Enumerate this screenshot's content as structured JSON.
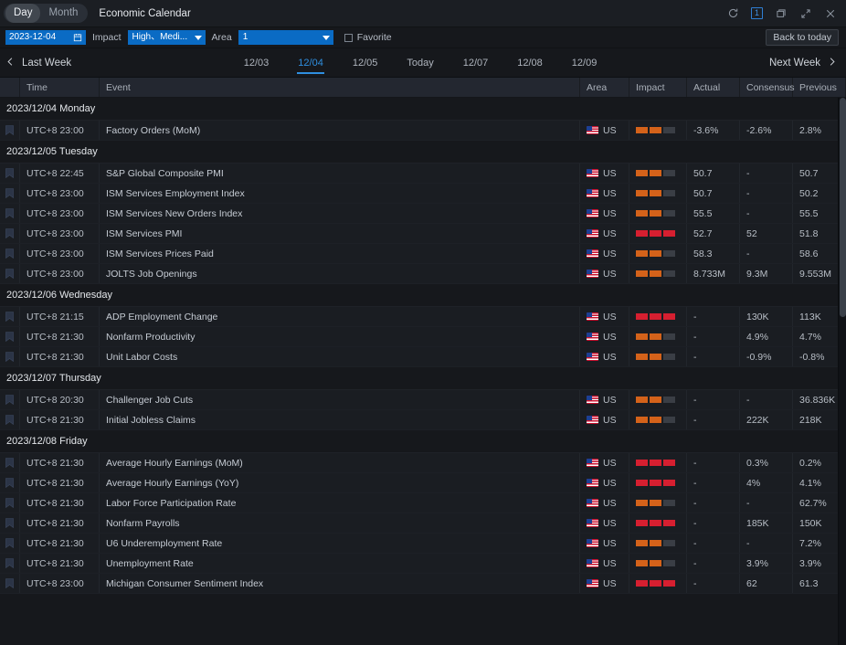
{
  "titlebar": {
    "view_tabs": [
      {
        "label": "Day",
        "active": true
      },
      {
        "label": "Month",
        "active": false
      }
    ],
    "app_title": "Economic Calendar",
    "icons": [
      "refresh-icon",
      "badge-one",
      "restore-window-icon",
      "expand-icon",
      "close-icon"
    ],
    "badge_text": "1"
  },
  "filterbar": {
    "date_value": "2023-12-04",
    "impact_label": "Impact",
    "impact_value": "High、Medi...",
    "area_label": "Area",
    "area_value": "1",
    "favorite_label": "Favorite",
    "back_to_today": "Back to today"
  },
  "weeknav": {
    "prev_label": "Last Week",
    "next_label": "Next Week",
    "days": [
      {
        "label": "12/03",
        "active": false
      },
      {
        "label": "12/04",
        "active": true
      },
      {
        "label": "12/05",
        "active": false
      },
      {
        "label": "Today",
        "active": false
      },
      {
        "label": "12/07",
        "active": false
      },
      {
        "label": "12/08",
        "active": false
      },
      {
        "label": "12/09",
        "active": false
      }
    ]
  },
  "table": {
    "columns": [
      "",
      "Time",
      "Event",
      "Area",
      "Impact",
      "Actual",
      "Consensus",
      "Previous"
    ],
    "groups": [
      {
        "label": "2023/12/04 Monday",
        "rows": [
          {
            "time": "UTC+8 23:00",
            "event": "Factory Orders (MoM)",
            "area": "US",
            "impact": "medium",
            "actual": "-3.6%",
            "consensus": "-2.6%",
            "previous": "2.8%"
          }
        ]
      },
      {
        "label": "2023/12/05 Tuesday",
        "rows": [
          {
            "time": "UTC+8 22:45",
            "event": "S&P Global Composite PMI",
            "area": "US",
            "impact": "medium",
            "actual": "50.7",
            "consensus": "-",
            "previous": "50.7"
          },
          {
            "time": "UTC+8 23:00",
            "event": "ISM Services Employment Index",
            "area": "US",
            "impact": "medium",
            "actual": "50.7",
            "consensus": "-",
            "previous": "50.2"
          },
          {
            "time": "UTC+8 23:00",
            "event": "ISM Services New Orders Index",
            "area": "US",
            "impact": "medium",
            "actual": "55.5",
            "consensus": "-",
            "previous": "55.5"
          },
          {
            "time": "UTC+8 23:00",
            "event": "ISM Services PMI",
            "area": "US",
            "impact": "high",
            "actual": "52.7",
            "consensus": "52",
            "previous": "51.8"
          },
          {
            "time": "UTC+8 23:00",
            "event": "ISM Services Prices Paid",
            "area": "US",
            "impact": "medium",
            "actual": "58.3",
            "consensus": "-",
            "previous": "58.6"
          },
          {
            "time": "UTC+8 23:00",
            "event": "JOLTS Job Openings",
            "area": "US",
            "impact": "medium",
            "actual": "8.733M",
            "consensus": "9.3M",
            "previous": "9.553M"
          }
        ]
      },
      {
        "label": "2023/12/06 Wednesday",
        "rows": [
          {
            "time": "UTC+8 21:15",
            "event": "ADP Employment Change",
            "area": "US",
            "impact": "high",
            "actual": "-",
            "consensus": "130K",
            "previous": "113K"
          },
          {
            "time": "UTC+8 21:30",
            "event": "Nonfarm Productivity",
            "area": "US",
            "impact": "medium",
            "actual": "-",
            "consensus": "4.9%",
            "previous": "4.7%"
          },
          {
            "time": "UTC+8 21:30",
            "event": "Unit Labor Costs",
            "area": "US",
            "impact": "medium",
            "actual": "-",
            "consensus": "-0.9%",
            "previous": "-0.8%"
          }
        ]
      },
      {
        "label": "2023/12/07 Thursday",
        "rows": [
          {
            "time": "UTC+8 20:30",
            "event": "Challenger Job Cuts",
            "area": "US",
            "impact": "medium",
            "actual": "-",
            "consensus": "-",
            "previous": "36.836K"
          },
          {
            "time": "UTC+8 21:30",
            "event": "Initial Jobless Claims",
            "area": "US",
            "impact": "medium",
            "actual": "-",
            "consensus": "222K",
            "previous": "218K"
          }
        ]
      },
      {
        "label": "2023/12/08 Friday",
        "rows": [
          {
            "time": "UTC+8 21:30",
            "event": "Average Hourly Earnings (MoM)",
            "area": "US",
            "impact": "high",
            "actual": "-",
            "consensus": "0.3%",
            "previous": "0.2%"
          },
          {
            "time": "UTC+8 21:30",
            "event": "Average Hourly Earnings (YoY)",
            "area": "US",
            "impact": "high",
            "actual": "-",
            "consensus": "4%",
            "previous": "4.1%"
          },
          {
            "time": "UTC+8 21:30",
            "event": "Labor Force Participation Rate",
            "area": "US",
            "impact": "medium",
            "actual": "-",
            "consensus": "-",
            "previous": "62.7%"
          },
          {
            "time": "UTC+8 21:30",
            "event": "Nonfarm Payrolls",
            "area": "US",
            "impact": "high",
            "actual": "-",
            "consensus": "185K",
            "previous": "150K"
          },
          {
            "time": "UTC+8 21:30",
            "event": "U6 Underemployment Rate",
            "area": "US",
            "impact": "medium",
            "actual": "-",
            "consensus": "-",
            "previous": "7.2%"
          },
          {
            "time": "UTC+8 21:30",
            "event": "Unemployment Rate",
            "area": "US",
            "impact": "medium",
            "actual": "-",
            "consensus": "3.9%",
            "previous": "3.9%"
          },
          {
            "time": "UTC+8 23:00",
            "event": "Michigan Consumer Sentiment Index",
            "area": "US",
            "impact": "high",
            "actual": "-",
            "consensus": "62",
            "previous": "61.3"
          }
        ]
      }
    ]
  },
  "colors": {
    "accent_blue": "#0a6bc4",
    "active_tab": "#2f8fe0",
    "impact_medium": "#d4621a",
    "impact_high": "#d61f30",
    "impact_empty": "#3a3e45"
  }
}
